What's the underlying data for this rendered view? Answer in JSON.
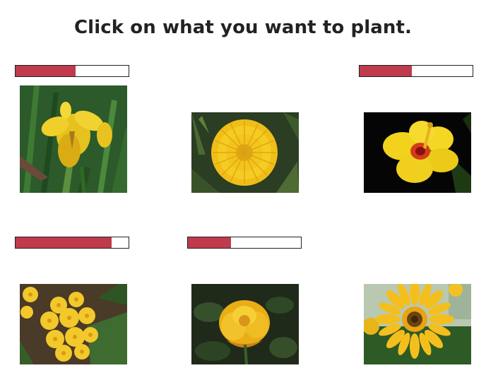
{
  "prompt": "Click on what you want to plant.",
  "colors": {
    "bar_fill": "#bf3a4d",
    "bar_border": "#222222"
  },
  "flowers": [
    {
      "id": "iris",
      "icon": "yellow-iris-photo",
      "progress": 0.53
    },
    {
      "id": "dandelion",
      "icon": "yellow-dandelion-photo",
      "progress": null
    },
    {
      "id": "hibiscus",
      "icon": "yellow-hibiscus-photo",
      "progress": 0.46
    },
    {
      "id": "primrose",
      "icon": "yellow-primrose-photo",
      "progress": 0.85
    },
    {
      "id": "rose",
      "icon": "yellow-rose-photo",
      "progress": 0.38
    },
    {
      "id": "gerbera",
      "icon": "yellow-gerbera-photo",
      "progress": null
    }
  ]
}
